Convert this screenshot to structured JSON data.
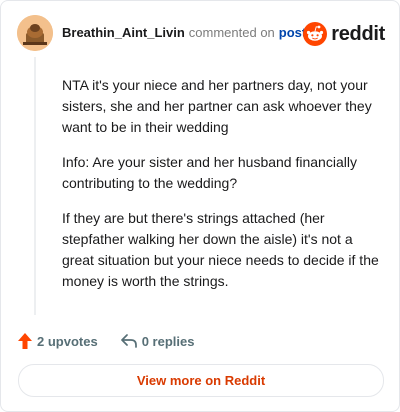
{
  "comment": {
    "username": "Breathin_Aint_Livin",
    "action_text": "commented on",
    "post_link": "post",
    "paragraphs": [
      "NTA it's your niece and her partners day, not your sisters, she and her partner can ask whoever they want to be in their wedding",
      "Info: Are your sister and her husband financially contributing to the wedding?",
      "If they are but there's strings attached (her stepfather walking her down the aisle) it's not a great situation but your niece needs to decide if the money is worth the strings."
    ]
  },
  "brand": {
    "name": "reddit",
    "accent_color": "#ff4500"
  },
  "actions": {
    "upvotes": "2 upvotes",
    "replies": "0 replies"
  },
  "footer": {
    "view_more": "View more on Reddit"
  },
  "colors": {
    "upvote_arrow": "#ff4500",
    "view_more_text": "#d93a00",
    "link": "#0045ac"
  },
  "icons": {
    "avatar": "avatar-image",
    "brand": "reddit-logo-icon",
    "upvote": "upvote-arrow-icon",
    "reply": "reply-arrow-icon"
  }
}
